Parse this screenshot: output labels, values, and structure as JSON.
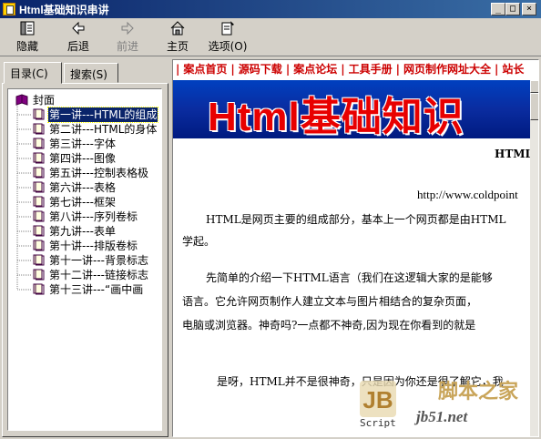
{
  "window": {
    "title": "Html基础知识串讲",
    "minimize_label": "_",
    "maximize_label": "□",
    "close_label": "×"
  },
  "toolbar": {
    "hide": {
      "label": "隐藏",
      "icon": "hide-pane-icon"
    },
    "back": {
      "label": "后退",
      "icon": "back-arrow-icon"
    },
    "forward": {
      "label": "前进",
      "icon": "forward-arrow-icon",
      "enabled": false
    },
    "home": {
      "label": "主页",
      "icon": "home-icon"
    },
    "options": {
      "label": "选项(O)",
      "icon": "options-icon"
    }
  },
  "tabs": [
    {
      "label": "目录(C)",
      "active": true
    },
    {
      "label": "搜索(S)",
      "active": false
    }
  ],
  "tree": {
    "root": "封面",
    "items": [
      "第一讲---HTML的组成",
      "第二讲---HTML的身体",
      "第三讲---字体",
      "第四讲---图像",
      "第五讲---控制表格极",
      "第六讲---表格",
      "第七讲---框架",
      "第八讲---序列卷标",
      "第九讲---表单",
      "第十讲---排版卷标",
      "第十一讲---背景标志",
      "第十二讲---链接标志",
      "第十三讲---“画中画"
    ],
    "selected_index": 0
  },
  "links": [
    "案点首页",
    "源码下载",
    "案点论坛",
    "工具手册",
    "网页制作网址大全",
    "站长"
  ],
  "banner": {
    "text": "Html基础知识"
  },
  "content": {
    "heading": "HTML",
    "url": "http://www.coldpoint",
    "para1_line1": "HTML是网页主要的组成部分，基本上一个网页都是由HTML",
    "para1_line2": "学起。",
    "para2_line1": "先简单的介绍一下HTML语言（我们在这逻辑大家的是能够",
    "para2_line2": "语言。它允许网页制作人建立文本与图片相结合的复杂页面，",
    "para2_line3": "电脑或浏览器。神奇吗?一点都不神奇,因为现在你看到的就是",
    "para3": "是呀，HTML并不是很神奇，只是因为你还是很了解它，我"
  },
  "watermark": {
    "logo_text": "JB",
    "script_text": "Script",
    "cn_text": "脚本之家",
    "url_text": "jb51.net"
  }
}
